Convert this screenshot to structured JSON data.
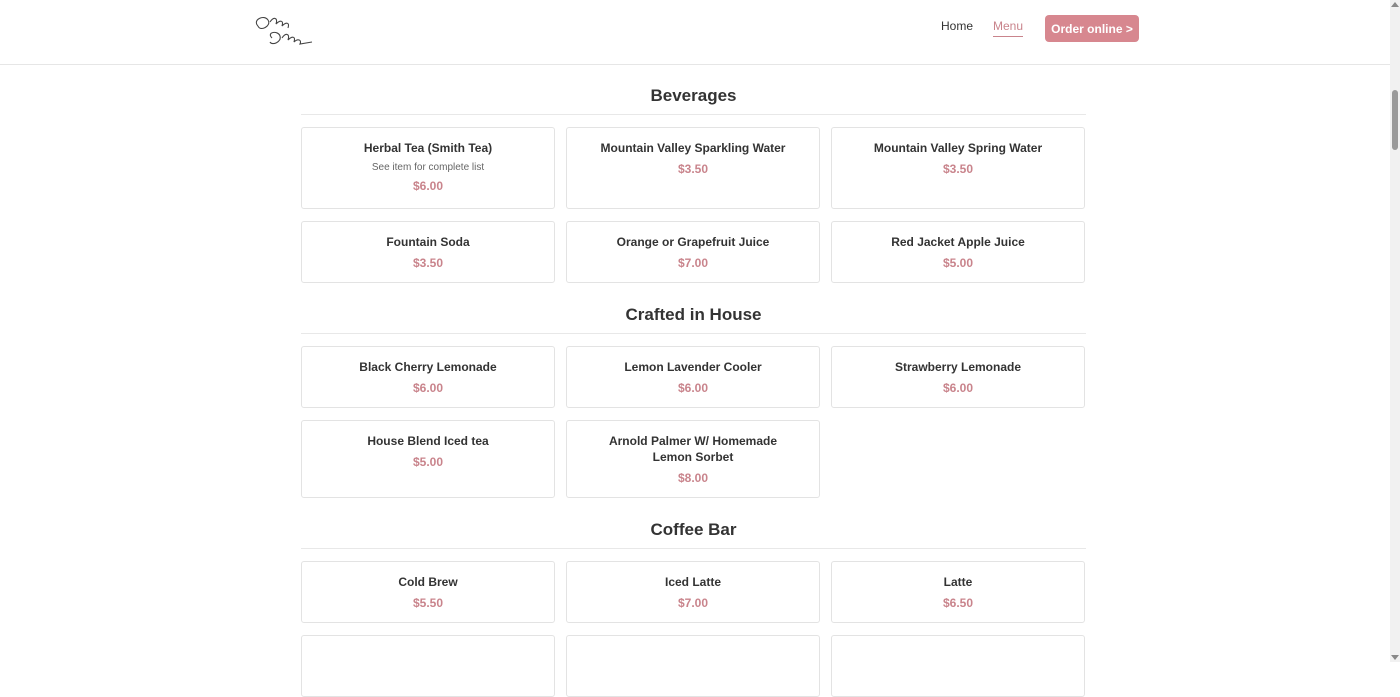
{
  "header": {
    "logo_text": "Onyx Cafe",
    "nav": {
      "home": "Home",
      "menu": "Menu"
    },
    "order_button": "Order online >"
  },
  "sections": [
    {
      "title": "Beverages",
      "items": [
        {
          "name": "Herbal Tea (Smith Tea)",
          "desc": "See item for complete list",
          "price": "$6.00"
        },
        {
          "name": "Mountain Valley Sparkling Water",
          "price": "$3.50"
        },
        {
          "name": "Mountain Valley Spring Water",
          "price": "$3.50"
        },
        {
          "name": "Fountain Soda",
          "price": "$3.50"
        },
        {
          "name": "Orange or Grapefruit Juice",
          "price": "$7.00"
        },
        {
          "name": "Red Jacket Apple Juice",
          "price": "$5.00"
        }
      ]
    },
    {
      "title": "Crafted in House",
      "items": [
        {
          "name": "Black Cherry Lemonade",
          "price": "$6.00"
        },
        {
          "name": "Lemon Lavender Cooler",
          "price": "$6.00"
        },
        {
          "name": "Strawberry Lemonade",
          "price": "$6.00"
        },
        {
          "name": "House Blend Iced tea",
          "price": "$5.00"
        },
        {
          "name": "Arnold Palmer W/ Homemade Lemon Sorbet",
          "price": "$8.00"
        }
      ]
    },
    {
      "title": "Coffee Bar",
      "items": [
        {
          "name": "Cold Brew",
          "price": "$5.50"
        },
        {
          "name": "Iced Latte",
          "price": "$7.00"
        },
        {
          "name": "Latte",
          "price": "$6.50"
        }
      ]
    }
  ],
  "colors": {
    "accent": "#d7878f",
    "accent_text": "#c9848c"
  }
}
